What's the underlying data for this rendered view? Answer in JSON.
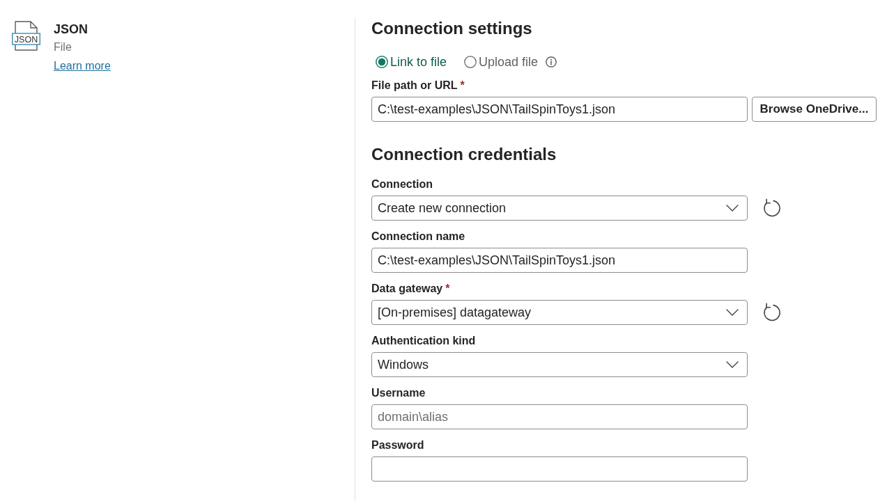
{
  "source": {
    "icon_text": "JSON",
    "title": "JSON",
    "subtitle": "File",
    "link": "Learn more"
  },
  "connection_settings": {
    "title": "Connection settings",
    "options": [
      {
        "label": "Link to file",
        "selected": true,
        "info": false
      },
      {
        "label": "Upload file",
        "selected": false,
        "info": true
      }
    ],
    "file_path": {
      "label": "File path or URL",
      "required_mark": "*",
      "value": "C:\\test-examples\\JSON\\TailSpinToys1.json"
    },
    "browse_button": "Browse OneDrive..."
  },
  "connection_credentials": {
    "title": "Connection credentials",
    "fields": [
      {
        "kind": "dropdown",
        "label": "Connection",
        "value": "Create new connection",
        "refresh": true
      },
      {
        "kind": "text",
        "label": "Connection name",
        "value": "C:\\test-examples\\JSON\\TailSpinToys1.json",
        "refresh": false
      },
      {
        "kind": "dropdown",
        "label": "Data gateway",
        "required_mark": "*",
        "value": "[On-premises] datagateway",
        "refresh": true
      },
      {
        "kind": "dropdown",
        "label": "Authentication kind",
        "value": "Windows",
        "refresh": false
      },
      {
        "kind": "text",
        "label": "Username",
        "placeholder": "domain\\alias",
        "refresh": false
      },
      {
        "kind": "password",
        "label": "Password",
        "refresh": false
      }
    ]
  }
}
